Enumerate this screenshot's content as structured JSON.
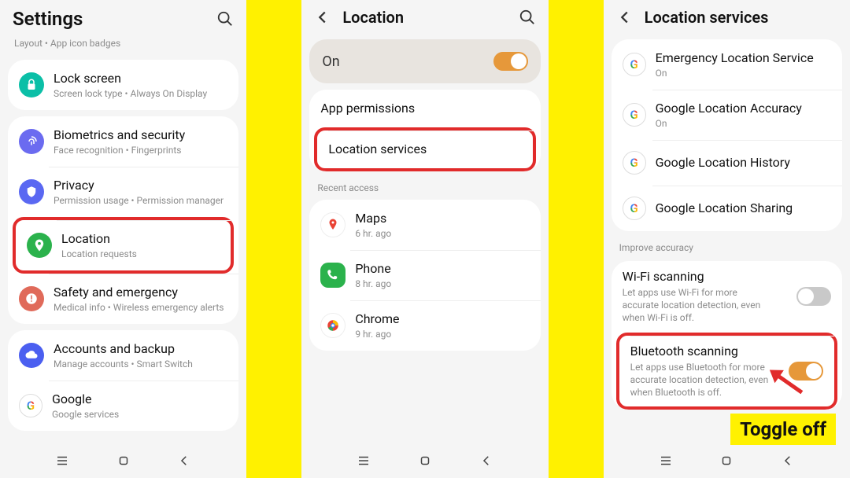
{
  "p1": {
    "title": "Settings",
    "cut_top": "Layout  •  App icon badges",
    "items": [
      {
        "icon": "lock",
        "color": "#0bbfa7",
        "title": "Lock screen",
        "sub": "Screen lock type  •  Always On Display"
      },
      {
        "icon": "finger",
        "color": "#6b6bf0",
        "title": "Biometrics and security",
        "sub": "Face recognition  •  Fingerprints"
      },
      {
        "icon": "shield",
        "color": "#5a68f2",
        "title": "Privacy",
        "sub": "Permission usage  •  Permission manager"
      },
      {
        "icon": "pin",
        "color": "#2bb24c",
        "title": "Location",
        "sub": "Location requests"
      },
      {
        "icon": "alert",
        "color": "#e06a5a",
        "title": "Safety and emergency",
        "sub": "Medical info  •  Wireless emergency alerts"
      },
      {
        "icon": "cloud",
        "color": "#4b5ff0",
        "title": "Accounts and backup",
        "sub": "Manage accounts  •  Smart Switch"
      },
      {
        "icon": "google",
        "color": "#fff",
        "title": "Google",
        "sub": "Google services"
      }
    ]
  },
  "p2": {
    "title": "Location",
    "on_label": "On",
    "items": [
      {
        "title": "App permissions"
      },
      {
        "title": "Location services"
      }
    ],
    "recent_label": "Recent access",
    "recent": [
      {
        "icon": "maps",
        "title": "Maps",
        "sub": "6 hr. ago"
      },
      {
        "icon": "phone",
        "title": "Phone",
        "sub": "8 hr. ago"
      },
      {
        "icon": "chrome",
        "title": "Chrome",
        "sub": "9 hr. ago"
      }
    ]
  },
  "p3": {
    "title": "Location services",
    "google": [
      {
        "title": "Emergency Location Service",
        "sub": "On"
      },
      {
        "title": "Google Location Accuracy",
        "sub": "On"
      },
      {
        "title": "Google Location History",
        "sub": ""
      },
      {
        "title": "Google Location Sharing",
        "sub": ""
      }
    ],
    "improve_label": "Improve accuracy",
    "scan": [
      {
        "title": "Wi-Fi scanning",
        "sub": "Let apps use Wi-Fi for more accurate location detection, even when Wi-Fi is off.",
        "on": false
      },
      {
        "title": "Bluetooth scanning",
        "sub": "Let apps use Bluetooth for more accurate location detection, even when Bluetooth is off.",
        "on": true
      }
    ],
    "toggle_label": "Toggle off"
  }
}
